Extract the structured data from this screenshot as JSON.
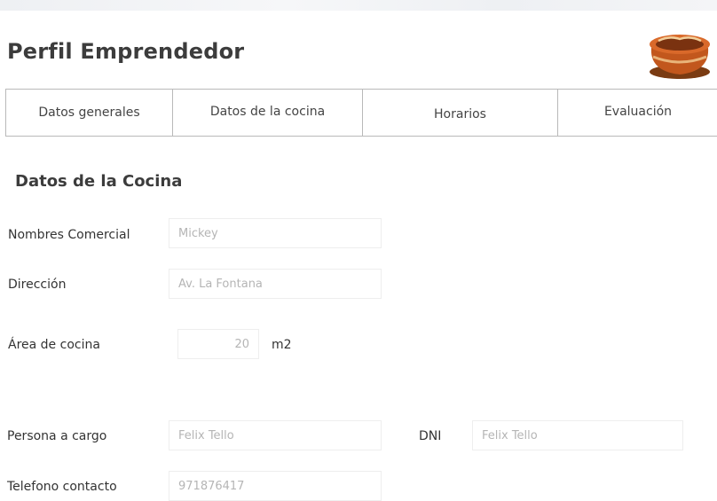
{
  "header": {
    "title": "Perfil Emprendedor",
    "logo_icon": "clay-pot-icon"
  },
  "tabs": [
    {
      "label": "Datos generales"
    },
    {
      "label": "Datos de la cocina"
    },
    {
      "label": "Horarios"
    },
    {
      "label": "Evaluación"
    }
  ],
  "section": {
    "title": "Datos de la Cocina"
  },
  "form": {
    "nombre_comercial": {
      "label": "Nombres Comercial",
      "value": "Mickey"
    },
    "direccion": {
      "label": "Dirección",
      "value": "Av. La Fontana"
    },
    "area_cocina": {
      "label": "Área de cocina",
      "value": "20",
      "unit": "m2"
    },
    "persona_cargo": {
      "label": "Persona a cargo",
      "value": "Felix Tello"
    },
    "dni": {
      "label": "DNI",
      "value": "Felix Tello"
    },
    "telefono": {
      "label": "Telefono contacto",
      "value": "971876417"
    }
  }
}
